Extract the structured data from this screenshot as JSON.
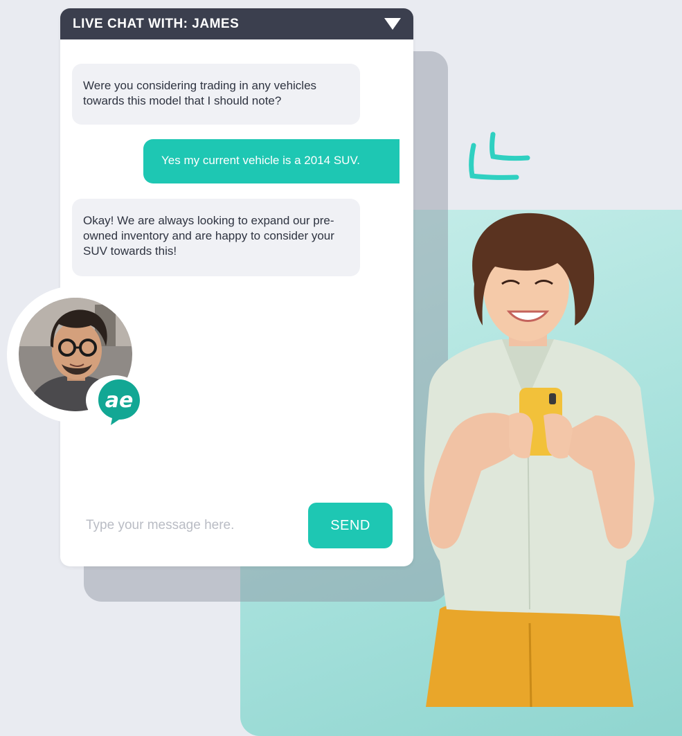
{
  "chat": {
    "title": "LIVE CHAT WITH: JAMES",
    "messages": [
      {
        "sender": "agent",
        "text": "Were you considering trading in any vehicles towards this model that I should note?"
      },
      {
        "sender": "user",
        "text": "Yes my current vehicle is a 2014 SUV."
      },
      {
        "sender": "agent",
        "text": "Okay! We are always looking to expand our pre-owned inventory and are happy to consider your SUV towards this!"
      }
    ],
    "input_placeholder": "Type your message here.",
    "send_label": "SEND"
  },
  "agent": {
    "brand_badge_text": "ae"
  },
  "colors": {
    "accent": "#1ec7b3",
    "header": "#3b3f4e",
    "agent_bubble": "#f0f1f5",
    "background": "#e9ebf1"
  },
  "icons": {
    "collapse": "triangle-down-icon",
    "decoration": "double-corner-icon"
  }
}
